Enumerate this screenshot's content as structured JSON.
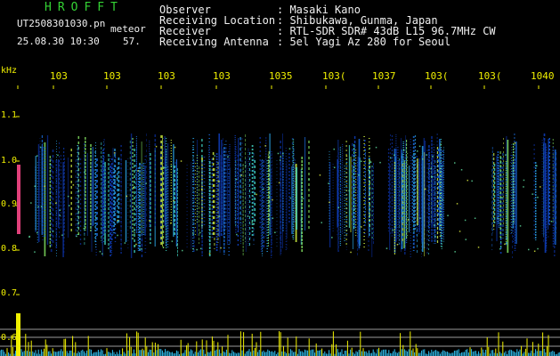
{
  "header": {
    "app_title": "HROFFT",
    "filename": "UT2508301030.pn",
    "mode_label": "meteor",
    "date_time": "25.08.30 10:30",
    "count": "57."
  },
  "info": [
    {
      "label": "Observer",
      "value": ": Masaki Kano"
    },
    {
      "label": "Receiving Location",
      "value": ": Shibukawa, Gunma, Japan"
    },
    {
      "label": "Receiver",
      "value": ": RTL-SDR SDR# 43dB L15 96.7MHz CW"
    },
    {
      "label": "Receiving Antenna",
      "value": ": 5el Yagi Az 280 for Seoul"
    }
  ],
  "axis": {
    "unit_label": "kHz",
    "x_ticks": [
      "103",
      "103",
      "103",
      "103",
      "1035",
      "103(",
      "1037",
      "103(",
      "103(",
      "1040"
    ],
    "y_ticks": [
      "1.1",
      "1.0",
      "0.9",
      "0.8",
      "0.7",
      "0.6"
    ]
  },
  "colors": {
    "label_green": "#34d234",
    "text_white": "#f0f0f0",
    "tick_yellow": "#f0f000",
    "marker_pink": "#e0407a"
  }
}
